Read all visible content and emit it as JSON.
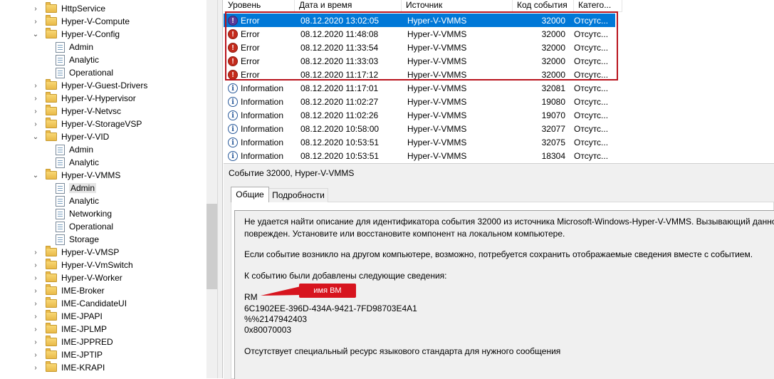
{
  "tree": {
    "items": [
      {
        "label": "HttpService",
        "chevron": "›",
        "icon": "folder"
      },
      {
        "label": "Hyper-V-Compute",
        "chevron": "›",
        "icon": "folder"
      },
      {
        "label": "Hyper-V-Config",
        "chevron": "⌄",
        "icon": "folder"
      },
      {
        "label": "Admin",
        "icon": "log"
      },
      {
        "label": "Analytic",
        "icon": "log"
      },
      {
        "label": "Operational",
        "icon": "log"
      },
      {
        "label": "Hyper-V-Guest-Drivers",
        "chevron": "›",
        "icon": "folder"
      },
      {
        "label": "Hyper-V-Hypervisor",
        "chevron": "›",
        "icon": "folder"
      },
      {
        "label": "Hyper-V-Netvsc",
        "chevron": "›",
        "icon": "folder"
      },
      {
        "label": "Hyper-V-StorageVSP",
        "chevron": "›",
        "icon": "folder"
      },
      {
        "label": "Hyper-V-VID",
        "chevron": "⌄",
        "icon": "folder"
      },
      {
        "label": "Admin",
        "icon": "log"
      },
      {
        "label": "Analytic",
        "icon": "log"
      },
      {
        "label": "Hyper-V-VMMS",
        "chevron": "⌄",
        "icon": "folder"
      },
      {
        "label": "Admin",
        "icon": "log"
      },
      {
        "label": "Analytic",
        "icon": "log"
      },
      {
        "label": "Networking",
        "icon": "log"
      },
      {
        "label": "Operational",
        "icon": "log"
      },
      {
        "label": "Storage",
        "icon": "log"
      },
      {
        "label": "Hyper-V-VMSP",
        "chevron": "›",
        "icon": "folder"
      },
      {
        "label": "Hyper-V-VmSwitch",
        "chevron": "›",
        "icon": "folder"
      },
      {
        "label": "Hyper-V-Worker",
        "chevron": "›",
        "icon": "folder"
      },
      {
        "label": "IME-Broker",
        "chevron": "›",
        "icon": "folder"
      },
      {
        "label": "IME-CandidateUI",
        "chevron": "›",
        "icon": "folder"
      },
      {
        "label": "IME-JPAPI",
        "chevron": "›",
        "icon": "folder"
      },
      {
        "label": "IME-JPLMP",
        "chevron": "›",
        "icon": "folder"
      },
      {
        "label": "IME-JPPRED",
        "chevron": "›",
        "icon": "folder"
      },
      {
        "label": "IME-JPTIP",
        "chevron": "›",
        "icon": "folder"
      },
      {
        "label": "IME-KRAPI",
        "chevron": "›",
        "icon": "folder"
      }
    ]
  },
  "events": {
    "columns": [
      "Уровень",
      "Дата и время",
      "Источник",
      "Код события",
      "Катего..."
    ],
    "rows": [
      {
        "level": "Error",
        "date": "08.12.2020 13:02:05",
        "source": "Hyper-V-VMMS",
        "id": "32000",
        "category": "Отсутс...",
        "selected": true
      },
      {
        "level": "Error",
        "date": "08.12.2020 11:48:08",
        "source": "Hyper-V-VMMS",
        "id": "32000",
        "category": "Отсутс..."
      },
      {
        "level": "Error",
        "date": "08.12.2020 11:33:54",
        "source": "Hyper-V-VMMS",
        "id": "32000",
        "category": "Отсутс..."
      },
      {
        "level": "Error",
        "date": "08.12.2020 11:33:03",
        "source": "Hyper-V-VMMS",
        "id": "32000",
        "category": "Отсутс..."
      },
      {
        "level": "Error",
        "date": "08.12.2020 11:17:12",
        "source": "Hyper-V-VMMS",
        "id": "32000",
        "category": "Отсутс..."
      },
      {
        "level": "Information",
        "date": "08.12.2020 11:17:01",
        "source": "Hyper-V-VMMS",
        "id": "32081",
        "category": "Отсутс..."
      },
      {
        "level": "Information",
        "date": "08.12.2020 11:02:27",
        "source": "Hyper-V-VMMS",
        "id": "19080",
        "category": "Отсутс..."
      },
      {
        "level": "Information",
        "date": "08.12.2020 11:02:26",
        "source": "Hyper-V-VMMS",
        "id": "19070",
        "category": "Отсутс..."
      },
      {
        "level": "Information",
        "date": "08.12.2020 10:58:00",
        "source": "Hyper-V-VMMS",
        "id": "32077",
        "category": "Отсутс..."
      },
      {
        "level": "Information",
        "date": "08.12.2020 10:53:51",
        "source": "Hyper-V-VMMS",
        "id": "32075",
        "category": "Отсутс..."
      },
      {
        "level": "Information",
        "date": "08.12.2020 10:53:51",
        "source": "Hyper-V-VMMS",
        "id": "18304",
        "category": "Отсутс..."
      }
    ]
  },
  "details": {
    "title": "Событие 32000, Hyper-V-VMMS",
    "tabs": [
      "Общие",
      "Подробности"
    ],
    "lines": [
      "Не удается найти описание для идентификатора события 32000 из источника Microsoft-Windows-Hyper-V-VMMS. Вызывающий данное",
      "поврежден. Установите или восстановите компонент на локальном компьютере.",
      "Если событие возникло на другом компьютере, возможно, потребуется сохранить отображаемые сведения вместе с событием.",
      "К событию были добавлены следующие сведения:",
      "RM",
      "6C1902EE-396D-434A-9421-7FD98703E4A1",
      "%%2147942403",
      "0x80070003",
      "Отсутствует специальный ресурс языкового стандарта для нужного сообщения"
    ],
    "callout": "имя ВМ"
  }
}
